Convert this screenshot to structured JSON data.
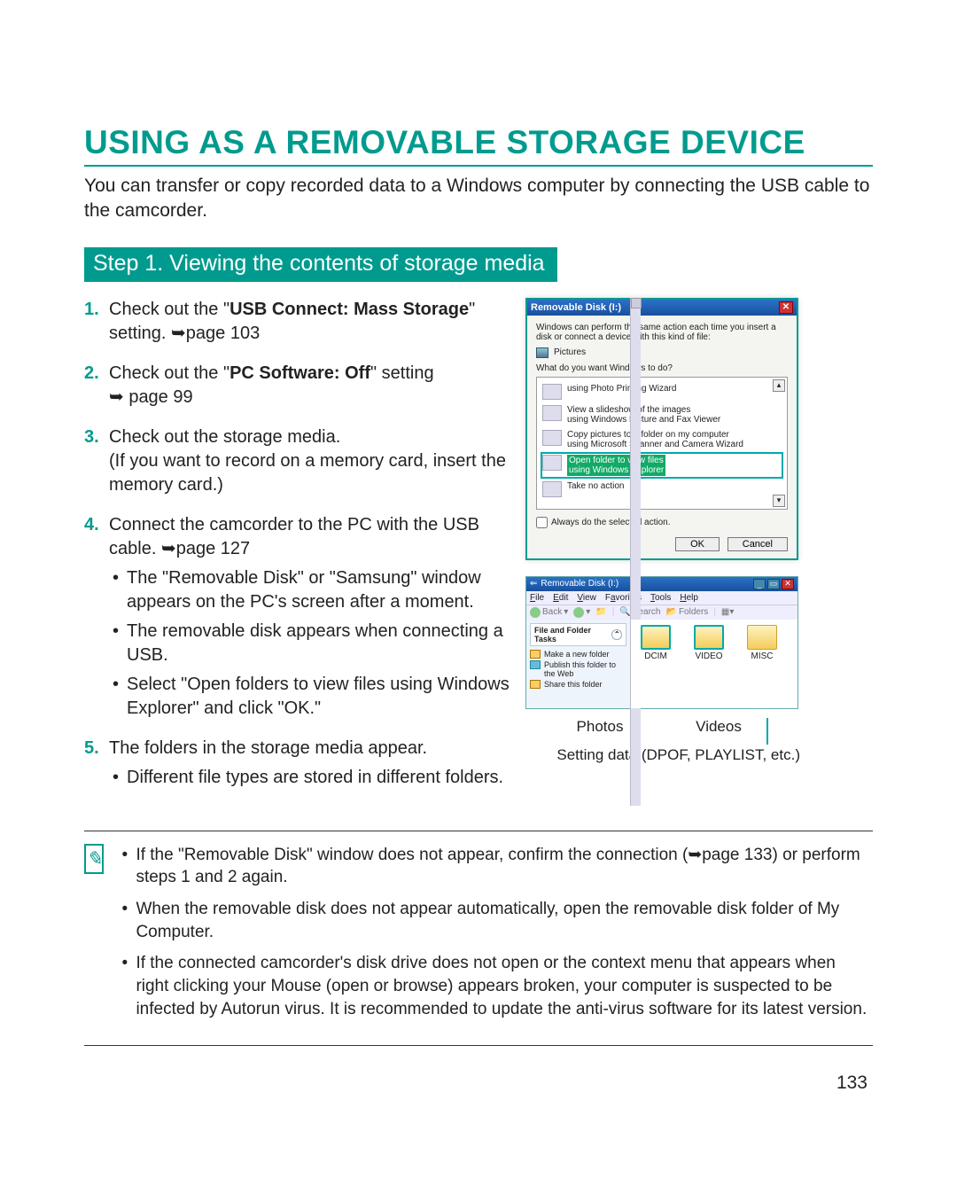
{
  "heading": "USING AS A REMOVABLE STORAGE DEVICE",
  "intro": "You can transfer or copy recorded data to a Windows computer by connecting the USB cable to the camcorder.",
  "step_title": "Step 1. Viewing the contents of storage media",
  "steps": {
    "s1a": "Check out the \"",
    "s1b": "USB Connect: Mass Storage",
    "s1c": "\" setting. ",
    "s1d": "➥page 103",
    "s2a": "Check out the \"",
    "s2b": "PC Software: Off",
    "s2c": "\" setting",
    "s2d": "➥ page 99",
    "s3a": "Check out the storage media.",
    "s3b": "(If you want to record on a memory card, insert the memory card.)",
    "s4a": "Connect the camcorder to the PC with the USB cable. ",
    "s4b": "➥page 127",
    "s4_b1": "The \"Removable Disk\" or \"Samsung\" window appears on the PC's screen after a moment.",
    "s4_b2": "The removable disk appears when connecting a USB.",
    "s4_b3": "Select \"Open folders to view files using Windows Explorer\" and click \"OK.\"",
    "s5a": "The folders in the storage media appear.",
    "s5_b1": "Different file types are stored in different folders."
  },
  "dialog": {
    "title": "Removable Disk (I:)",
    "close": "✕",
    "msg": "Windows can perform the same action each time you insert a disk or connect a device with this kind of file:",
    "pictures": "Pictures",
    "question": "What do you want Windows to do?",
    "opt1": "using Photo Printing Wizard",
    "opt2a": "View a slideshow of the images",
    "opt2b": "using Windows Picture and Fax Viewer",
    "opt3a": "Copy pictures to a folder on my computer",
    "opt3b": "using Microsoft Scanner and Camera Wizard",
    "opt4a": "Open folder to view files",
    "opt4b": "using Windows Explorer",
    "opt5": "Take no action",
    "always": "Always do the selected action.",
    "ok": "OK",
    "cancel": "Cancel"
  },
  "explorer": {
    "title": "Removable Disk (I:)",
    "menu": {
      "file": "File",
      "edit": "Edit",
      "view": "View",
      "fav": "Favorites",
      "tools": "Tools",
      "help": "Help"
    },
    "toolbar": {
      "back": "Back",
      "search": "Search",
      "folders": "Folders"
    },
    "side_header": "File and Folder Tasks",
    "side1": "Make a new folder",
    "side2": "Publish this folder to the Web",
    "side3": "Share this folder",
    "f1": "DCIM",
    "f2": "VIDEO",
    "f3": "MISC"
  },
  "annot": {
    "photos": "Photos",
    "videos": "Videos",
    "setting": "Setting data (DPOF, PLAYLIST, etc.)"
  },
  "notes": {
    "n1a": "If the \"Removable Disk\" window does not appear, confirm the connection (",
    "n1b": "➥page 133",
    "n1c": ") or perform steps 1 and 2 again.",
    "n2": "When the removable disk does not appear automatically, open the removable disk folder of My Computer.",
    "n3": "If the connected camcorder's disk drive does not open or the context menu that appears when right clicking your Mouse (open or browse) appears broken, your computer is suspected to be infected by Autorun virus. It is recommended to update the anti-virus software for its latest version."
  },
  "page_number": "133"
}
